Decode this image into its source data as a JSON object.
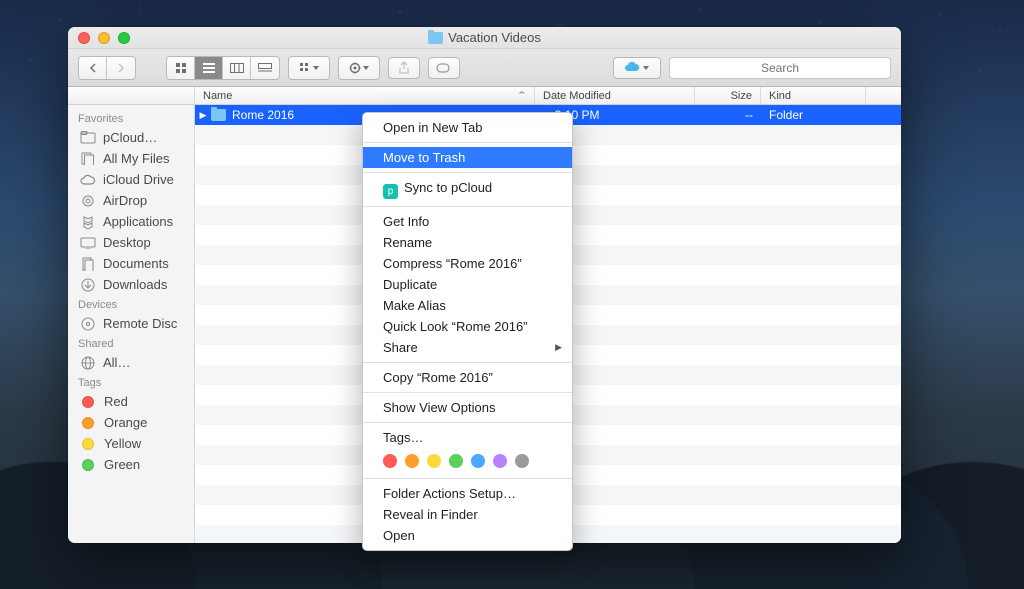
{
  "window": {
    "title": "Vacation Videos"
  },
  "toolbar": {
    "search_placeholder": "Search"
  },
  "columns": {
    "name": "Name",
    "date": "Date Modified",
    "size": "Size",
    "kind": "Kind",
    "name_w": 340,
    "date_w": 160,
    "size_w": 66,
    "kind_w": 105
  },
  "sidebar": {
    "sections": [
      {
        "header": "Favorites",
        "items": [
          {
            "icon": "pcloud",
            "label": "pCloud…"
          },
          {
            "icon": "allfiles",
            "label": "All My Files"
          },
          {
            "icon": "icloud",
            "label": "iCloud Drive"
          },
          {
            "icon": "airdrop",
            "label": "AirDrop"
          },
          {
            "icon": "apps",
            "label": "Applications"
          },
          {
            "icon": "desktop",
            "label": "Desktop"
          },
          {
            "icon": "docs",
            "label": "Documents"
          },
          {
            "icon": "downloads",
            "label": "Downloads"
          }
        ]
      },
      {
        "header": "Devices",
        "items": [
          {
            "icon": "disc",
            "label": "Remote Disc"
          }
        ]
      },
      {
        "header": "Shared",
        "items": [
          {
            "icon": "globe",
            "label": "All…"
          }
        ]
      },
      {
        "header": "Tags",
        "items": [
          {
            "icon": "tag",
            "color": "#ff5b52",
            "label": "Red"
          },
          {
            "icon": "tag",
            "color": "#ff9d2f",
            "label": "Orange"
          },
          {
            "icon": "tag",
            "color": "#ffd93a",
            "label": "Yellow"
          },
          {
            "icon": "tag",
            "color": "#5ad15a",
            "label": "Green"
          }
        ]
      }
    ]
  },
  "rows": [
    {
      "name": "Rome 2016",
      "date_visible": "y, 3:10 PM",
      "size": "--",
      "kind": "Folder",
      "selected": true
    }
  ],
  "context_menu": {
    "sections": [
      [
        {
          "label": "Open in New Tab"
        }
      ],
      [
        {
          "label": "Move to Trash",
          "highlight": true
        }
      ],
      [
        {
          "label": "Sync to pCloud",
          "pcloud_icon": true
        }
      ],
      [
        {
          "label": "Get Info"
        },
        {
          "label": "Rename"
        },
        {
          "label": "Compress “Rome 2016”"
        },
        {
          "label": "Duplicate"
        },
        {
          "label": "Make Alias"
        },
        {
          "label": "Quick Look “Rome 2016”"
        },
        {
          "label": "Share",
          "submenu": true
        }
      ],
      [
        {
          "label": "Copy “Rome 2016”"
        }
      ],
      [
        {
          "label": "Show View Options"
        }
      ],
      [
        {
          "label": "Tags…"
        },
        {
          "tag_colors": [
            "#ff5b52",
            "#ff9d2f",
            "#ffd93a",
            "#5ad15a",
            "#4aa8ff",
            "#b583ff",
            "#9b9b9b"
          ]
        }
      ],
      [
        {
          "label": "Folder Actions Setup…"
        },
        {
          "label": "Reveal in Finder"
        },
        {
          "label": "Open"
        }
      ]
    ]
  }
}
